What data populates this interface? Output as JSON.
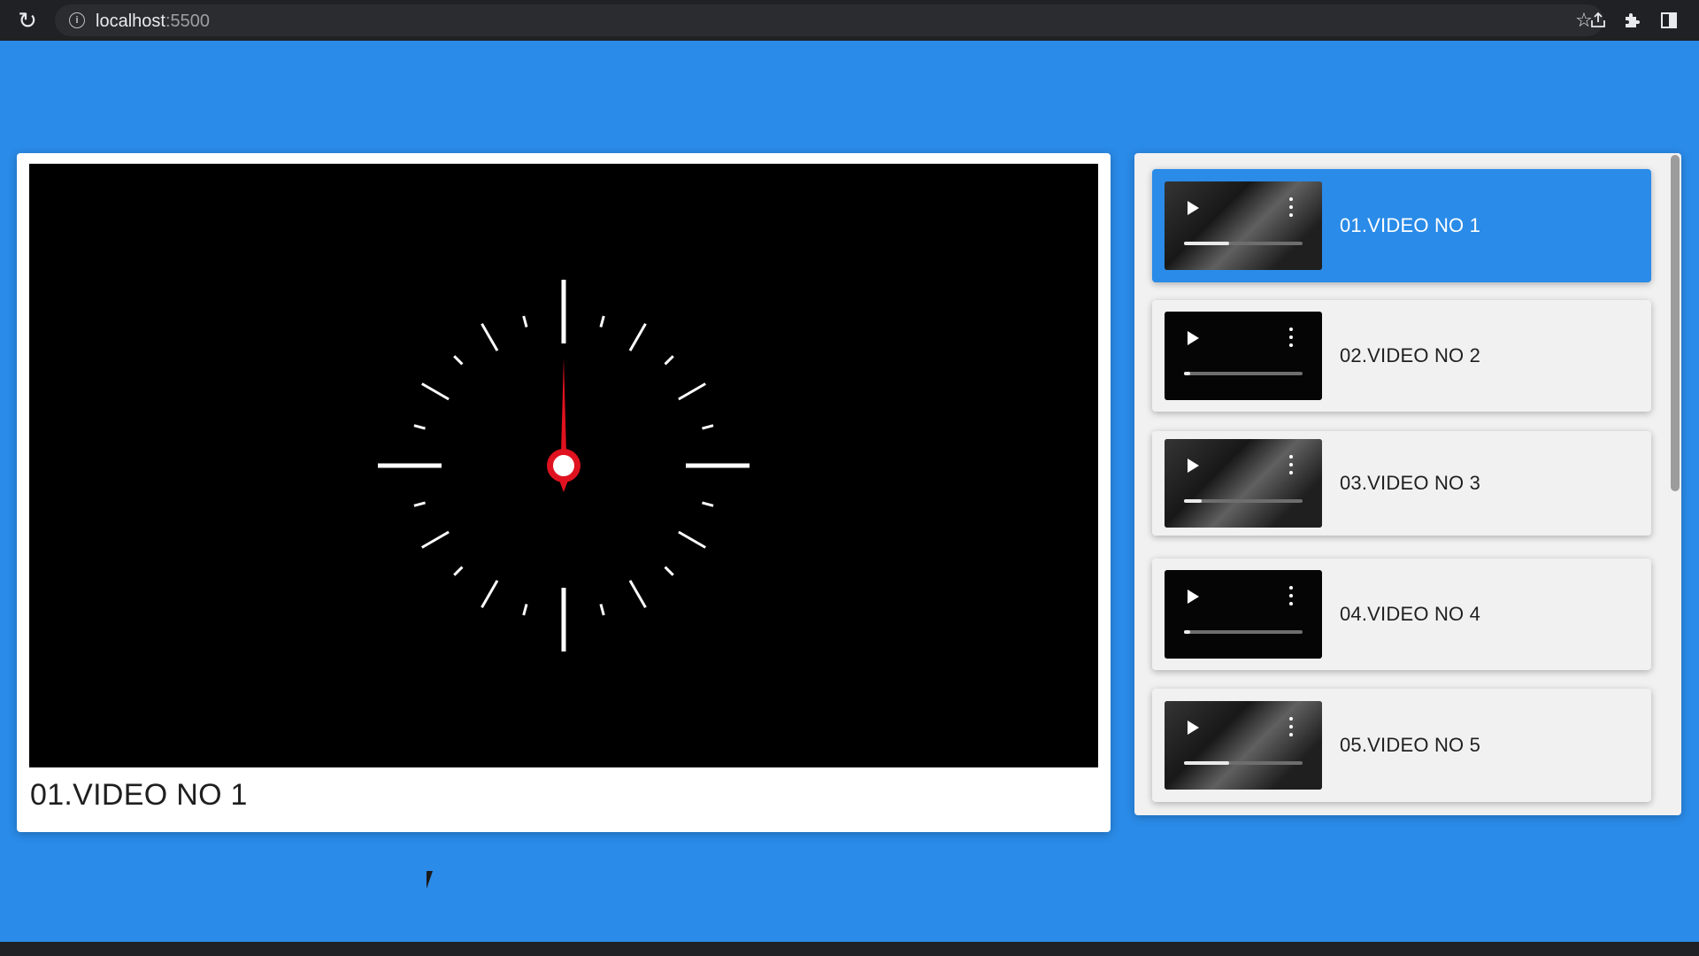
{
  "browser": {
    "url_host": "localhost",
    "url_port": ":5500",
    "icons": [
      "reload-icon",
      "site-info-icon",
      "share-icon",
      "bookmark-star-icon",
      "extensions-icon",
      "side-panel-icon"
    ]
  },
  "player": {
    "title": "01.VIDEO NO 1",
    "clock_hand_color": "#e0121f",
    "tick_color": "#ffffff"
  },
  "playlist": {
    "active_index": 0,
    "accent_color": "#2a8be8",
    "items": [
      {
        "label": "01.VIDEO NO 1",
        "progress": 0.38,
        "thumb": "clip"
      },
      {
        "label": "02.VIDEO NO 2",
        "progress": 0.05,
        "thumb": "blank"
      },
      {
        "label": "03.VIDEO NO 3",
        "progress": 0.15,
        "thumb": "clip"
      },
      {
        "label": "04.VIDEO NO 4",
        "progress": 0.05,
        "thumb": "blank"
      },
      {
        "label": "05.VIDEO NO 5",
        "progress": 0.38,
        "thumb": "clip"
      }
    ]
  }
}
